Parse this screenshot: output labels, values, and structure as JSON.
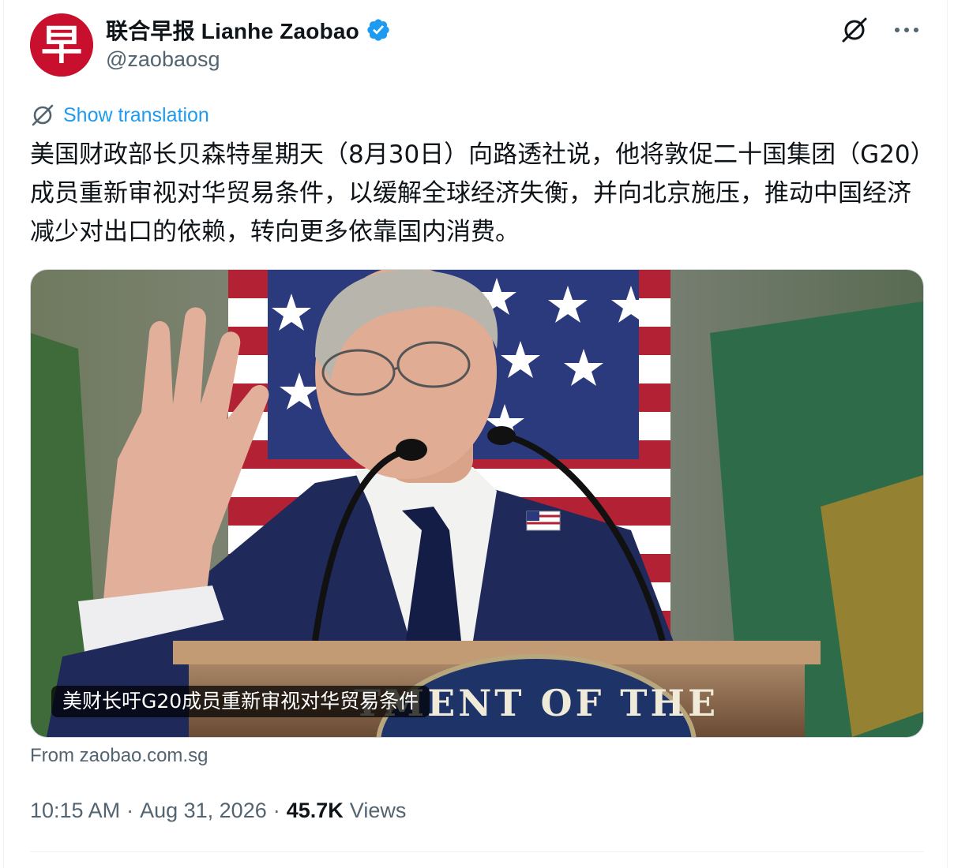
{
  "author": {
    "name": "联合早报 Lianhe Zaobao",
    "handle": "@zaobaosg",
    "avatar_glyph": "早",
    "avatar_color": "#c8102e",
    "verified": true,
    "verified_color": "#1d9bf0"
  },
  "actions": {
    "grok_icon": "grok-icon",
    "more_icon": "more-icon"
  },
  "translation": {
    "label": "Show translation",
    "icon": "translate-icon"
  },
  "tweet": {
    "text": "美国财政部长贝森特星期天（8月30日）向路透社说，他将敦促二十国集团（G20）成员重新审视对华贸易条件，以缓解全球经济失衡，并向北京施压，推动中国经济减少对出口的依赖，转向更多依靠国内消费。"
  },
  "card": {
    "caption": "美财长吁G20成员重新审视对华贸易条件",
    "seal_text": "TMENT OF THE",
    "source": "From zaobao.com.sg"
  },
  "meta": {
    "time": "10:15 AM",
    "sep1": "·",
    "date": "Aug 31, 2026",
    "sep2": "·",
    "views_count": "45.7K",
    "views_label": "Views"
  },
  "colors": {
    "link": "#1d9bf0",
    "secondary_text": "#536471",
    "primary_text": "#0f1419"
  }
}
